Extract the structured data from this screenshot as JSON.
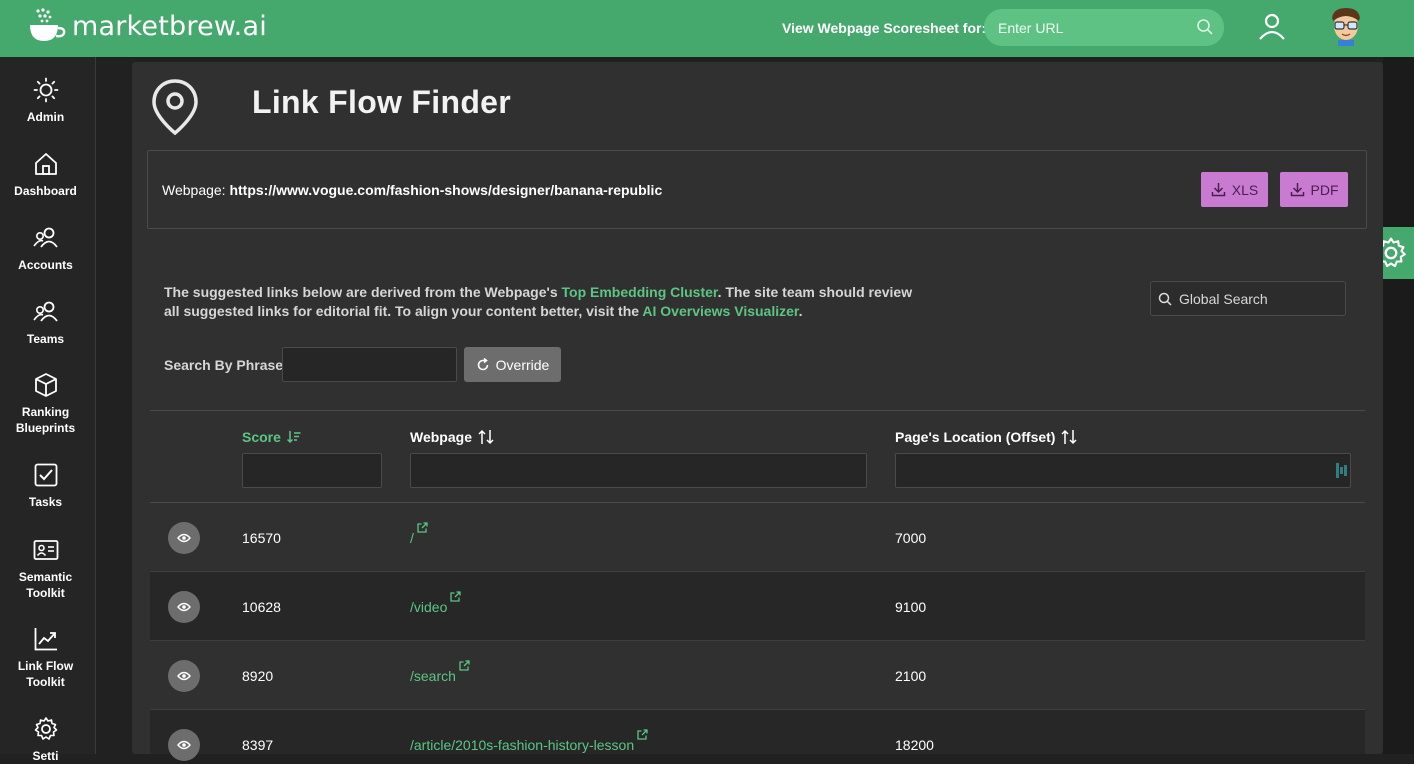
{
  "topbar": {
    "logo_text": "marketbrew.ai",
    "scoresheet_label": "View Webpage Scoresheet for:",
    "url_placeholder": "Enter URL"
  },
  "sidebar": {
    "items": [
      {
        "label": "Admin",
        "icon": "sun-icon"
      },
      {
        "label": "Dashboard",
        "icon": "home-icon"
      },
      {
        "label": "Accounts",
        "icon": "users-icon"
      },
      {
        "label": "Teams",
        "icon": "team-icon"
      },
      {
        "label": "Ranking Blueprints",
        "icon": "cube-icon"
      },
      {
        "label": "Tasks",
        "icon": "checkbox-icon"
      },
      {
        "label": "Semantic Toolkit",
        "icon": "id-card-icon"
      },
      {
        "label": "Link Flow Toolkit",
        "icon": "trend-chart-icon"
      },
      {
        "label": "Setti",
        "icon": "gear-icon"
      }
    ]
  },
  "page": {
    "title": "Link Flow Finder",
    "webpage_label": "Webpage:",
    "webpage_url": "https://www.vogue.com/fashion-shows/designer/banana-republic",
    "xls_label": "XLS",
    "pdf_label": "PDF"
  },
  "info": {
    "part1": "The suggested links below are derived from the Webpage's ",
    "link1": "Top Embedding Cluster",
    "part2": ". The site team should review all suggested links for editorial fit. To align your content better, visit the ",
    "link2": "AI Overviews Visualizer",
    "part3": "."
  },
  "global_search_placeholder": "Global Search",
  "phrase": {
    "label": "Search By Phrase:",
    "override_label": "Override"
  },
  "table": {
    "columns": [
      "Score",
      "Webpage",
      "Page's Location (Offset)"
    ],
    "rows": [
      {
        "score": "16570",
        "webpage": "/",
        "offset": "7000"
      },
      {
        "score": "10628",
        "webpage": "/video",
        "offset": "9100"
      },
      {
        "score": "8920",
        "webpage": "/search",
        "offset": "2100"
      },
      {
        "score": "8397",
        "webpage": "/article/2010s-fashion-history-lesson",
        "offset": "18200"
      }
    ]
  },
  "colors": {
    "brand_green": "#45a86c",
    "link_green": "#5cc584",
    "export_button": "#c97bd1"
  }
}
